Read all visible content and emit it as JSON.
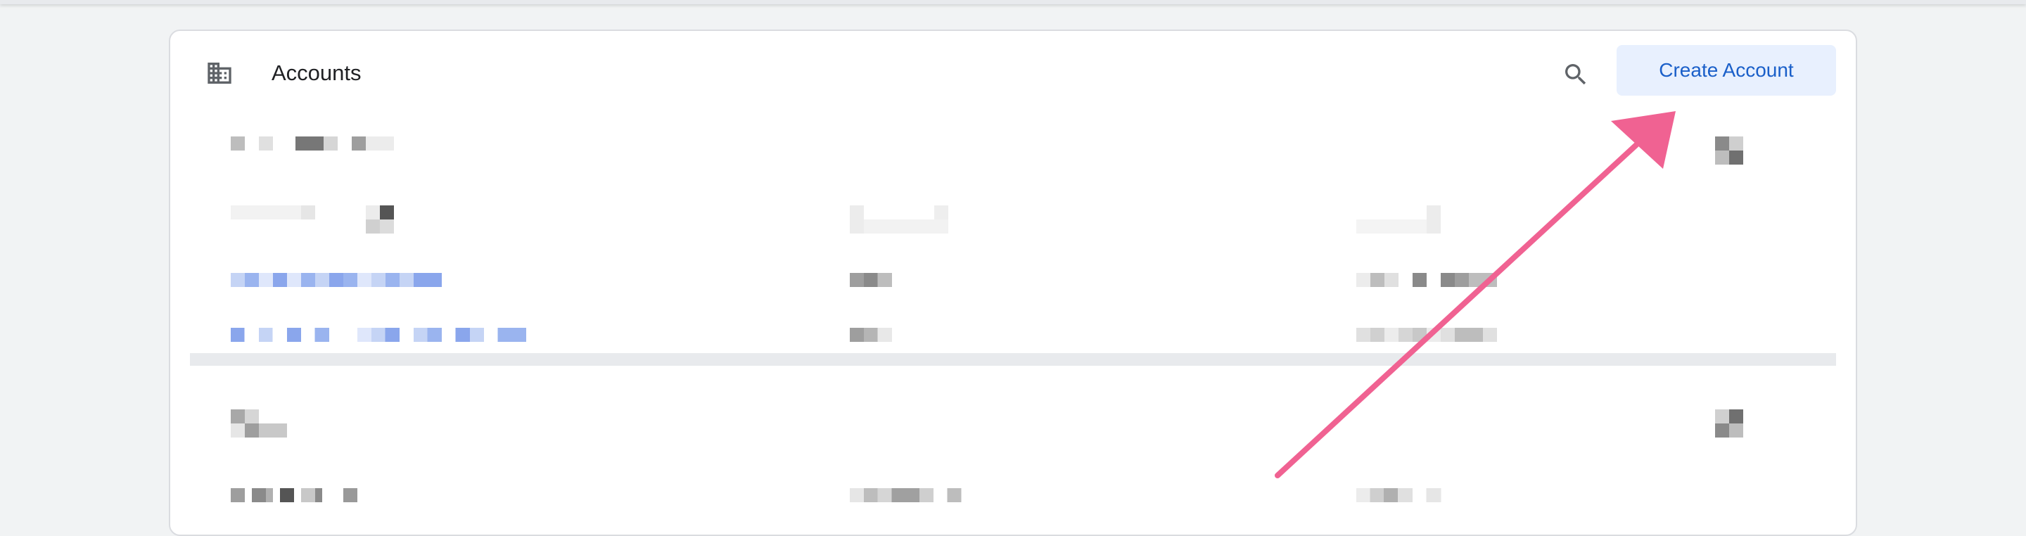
{
  "header": {
    "title": "Accounts",
    "create_button_label": "Create Account",
    "icons": {
      "section": "building-icon",
      "search": "search-icon"
    }
  },
  "colors": {
    "background": "#f1f3f4",
    "card": "#ffffff",
    "accent_text": "#1a5fc9",
    "accent_bg": "#e8f0fe",
    "annotation_arrow": "#f06292"
  },
  "redacted_groups": 2
}
